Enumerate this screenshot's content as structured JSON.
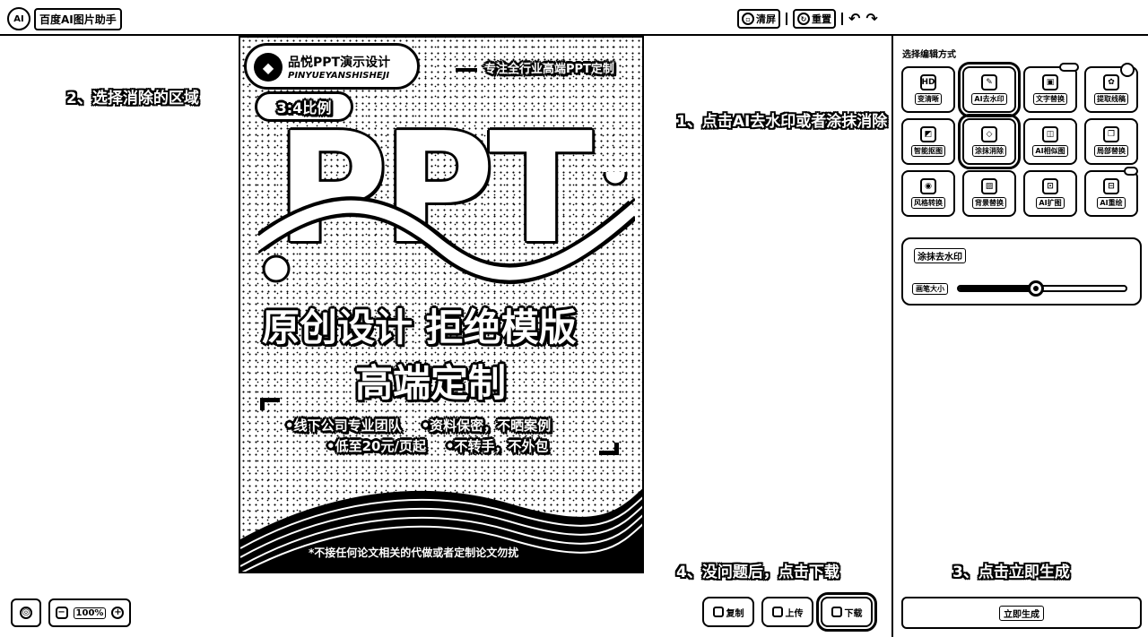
{
  "app": {
    "logo_text": "AI",
    "title": "百度AI图片助手"
  },
  "toolbar": {
    "clear_label": "清屏",
    "reset_label": "重置",
    "undo_icon": "undo-icon",
    "redo_icon": "redo-icon"
  },
  "annotations": {
    "step1": "1、点击AI去水印或者涂抹消除",
    "step2": "2、选择消除的区域",
    "step3": "3、点击立即生成",
    "step4": "4、没问题后，点击下载"
  },
  "poster": {
    "brand_name": "品悦PPT演示设计",
    "brand_pinyin": "PINYUEYANSHISHEJI",
    "ratio": "3:4比例",
    "tagline": "专注全行业高端PPT定制",
    "big_text": "PPT",
    "headline1": "原创设计 拒绝模版",
    "headline2": "高端定制",
    "bullets": [
      "•线下公司专业团队",
      "•资料保密，不晒案例",
      "•低至20元/页起",
      "•不转手，不外包"
    ],
    "disclaimer": "*不接任何论文相关的代做或者定制论文勿扰"
  },
  "panel": {
    "title": "选择编辑方式",
    "tools": [
      {
        "label": "变清晰",
        "icon": "HD"
      },
      {
        "label": "AI去水印",
        "icon": "✎",
        "selected": true
      },
      {
        "label": "文字替换",
        "icon": "▣"
      },
      {
        "label": "提取线稿",
        "icon": "✿",
        "badge": ""
      },
      {
        "label": "智能抠图",
        "icon": "◩"
      },
      {
        "label": "涂抹消除",
        "icon": "◇",
        "selected": true
      },
      {
        "label": "AI相似图",
        "icon": "◫"
      },
      {
        "label": "局部替换",
        "icon": "❐"
      },
      {
        "label": "风格转换",
        "icon": "◉"
      },
      {
        "label": "背景替换",
        "icon": "▨"
      },
      {
        "label": "AI扩图",
        "icon": "⊡"
      },
      {
        "label": "AI重绘",
        "icon": "⊟",
        "badge": ""
      }
    ],
    "erase": {
      "title": "涂抹去水印",
      "brush_label": "画笔大小",
      "brush_level": 0.46
    },
    "generate_label": "立即生成"
  },
  "zoom": {
    "value": "100%"
  },
  "actions": {
    "copy_label": "复制",
    "upload_label": "上传",
    "download_label": "下载"
  }
}
